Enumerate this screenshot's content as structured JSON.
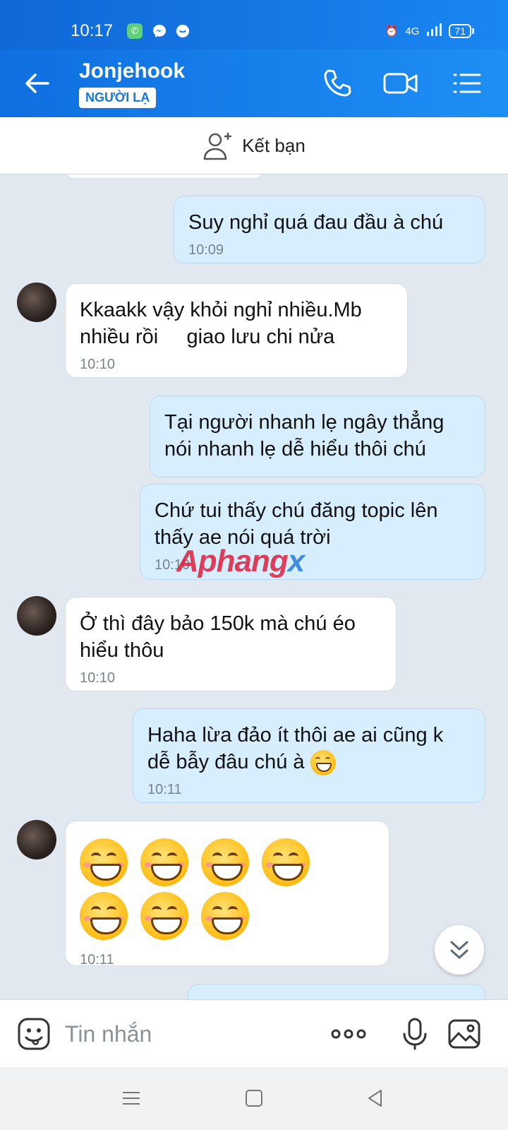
{
  "status_bar": {
    "time": "10:17",
    "network": "4G",
    "battery": "71"
  },
  "header": {
    "contact_name": "Jonjehook",
    "badge": "NGƯỜI LẠ"
  },
  "friend_bar": {
    "label": "Kết bạn"
  },
  "messages": [
    {
      "side": "out",
      "text": "Suy nghỉ quá đau đầu à chú",
      "time": "10:09"
    },
    {
      "side": "in",
      "text": "Kkaakk vậy khỏi nghỉ nhiều.Mb nhiều rồi     giao lưu chi nửa",
      "time": "10:10"
    },
    {
      "side": "out",
      "text": "Tại người nhanh lẹ ngây thẳng nói nhanh lẹ dễ hiểu thôi chú",
      "time": ""
    },
    {
      "side": "out",
      "text": "Chứ tui thấy chú đăng topic lên thấy ae nói quá trời",
      "time": "10:10"
    },
    {
      "side": "in",
      "text": "Ở thì đây bảo 150k mà chú éo hiểu thôu",
      "time": "10:10"
    },
    {
      "side": "out",
      "text": "Haha lừa đảo ít thôi ae ai cũng k dễ bẫy đâu chú à",
      "time": "10:11",
      "emoji": "grinning-face"
    },
    {
      "side": "in",
      "emoji_count": 7,
      "emoji": "grinning-face",
      "time": "10:11"
    }
  ],
  "watermark": {
    "part1": "Aphang",
    "part2": "x"
  },
  "input": {
    "placeholder": "Tin nhắn"
  },
  "colors": {
    "header": "#1a86f2",
    "outgoing": "#d6eefd",
    "incoming": "#ffffff",
    "background": "#e2e8ef"
  }
}
